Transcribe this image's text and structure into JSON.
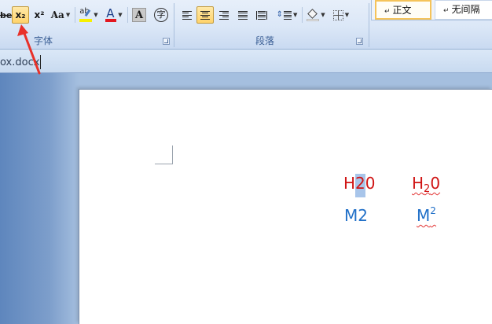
{
  "ribbon": {
    "font_group": {
      "label": "字体",
      "strike_label": "abe",
      "subscript_label": "x₂",
      "superscript_label": "x²",
      "change_case_label": "Aa",
      "highlight_label": "ab",
      "font_color_label": "A",
      "char_shading_label": "A",
      "enclose_label": "字"
    },
    "paragraph_group": {
      "label": "段落"
    },
    "styles": [
      {
        "label": "正文",
        "mark": "↵"
      },
      {
        "label": "无间隔",
        "mark": "↵"
      }
    ]
  },
  "titlebar": {
    "filename": "ox.docx"
  },
  "document": {
    "row1_left": {
      "part1": "H",
      "part2_selected": "2",
      "part3": "0"
    },
    "row1_right": {
      "base": "H",
      "sub": "2",
      "tail": "0"
    },
    "row2_left": "M2",
    "row2_right": {
      "base": "M",
      "sup": "2"
    }
  },
  "colors": {
    "red_text": "#d01414",
    "blue_text": "#2170c8",
    "selection": "#a8c5ea",
    "annotation_arrow": "#e8312a"
  }
}
